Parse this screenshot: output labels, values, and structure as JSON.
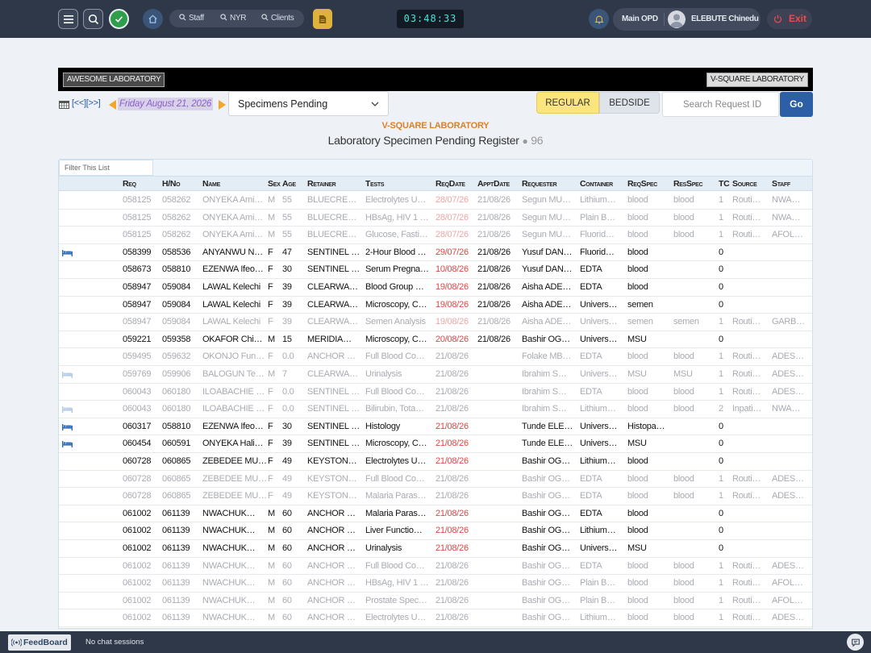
{
  "topbar": {
    "search_items": [
      {
        "label": "Staff",
        "icon": "search-icon"
      },
      {
        "label": "NYR",
        "icon": "search-icon"
      },
      {
        "label": "Clients",
        "icon": "search-icon"
      }
    ],
    "clock": "03:48:33",
    "department": "Main OPD",
    "user_name": "ELEBUTE Chinedu",
    "exit_label": "Exit"
  },
  "labbar": {
    "left_button": "AWESOME LABORATORY",
    "right_button": "V-SQUARE LABORATORY"
  },
  "controls": {
    "nav_links": "[<<][>>]",
    "date": "Friday August 21, 2026",
    "filter_select": "Specimens Pending",
    "segment_regular": "REGULAR",
    "segment_bedside": "BEDSIDE",
    "search_placeholder": "Search Request ID",
    "go_label": "Go"
  },
  "header": {
    "lab_name": "V-SQUARE LABORATORY",
    "register_title": "Laboratory Specimen Pending Register",
    "count": "96"
  },
  "table": {
    "filter_placeholder": "Filter This List",
    "columns": [
      "Req",
      "H/No",
      "Name",
      "Sex",
      "Age",
      "Retainer",
      "Tests",
      "ReqDate",
      "ApptDate",
      "Requester",
      "Container",
      "ReqSpec",
      "ResSpec",
      "TC",
      "Source",
      "Staff"
    ],
    "rows": [
      {
        "faded": true,
        "bed": false,
        "overdue": true,
        "cells": [
          "058125",
          "058262",
          "ONYEKA Ami…",
          "M",
          "55",
          "BLUECRE…",
          "Electrolytes U…",
          "28/07/26",
          "21/08/26",
          "Segun MU…",
          "Lithium…",
          "blood",
          "blood",
          "1",
          "Routi…",
          "NWA…"
        ]
      },
      {
        "faded": true,
        "bed": false,
        "overdue": true,
        "cells": [
          "058125",
          "058262",
          "ONYEKA Ami…",
          "M",
          "55",
          "BLUECRE…",
          "HBsAg, HIV 1 …",
          "28/07/26",
          "21/08/26",
          "Segun MU…",
          "Plain B…",
          "blood",
          "blood",
          "1",
          "Routi…",
          "NWA…"
        ]
      },
      {
        "faded": true,
        "bed": false,
        "overdue": true,
        "cells": [
          "058125",
          "058262",
          "ONYEKA Ami…",
          "M",
          "55",
          "BLUECRE…",
          "Glucose, Fasti…",
          "28/07/26",
          "21/08/26",
          "Segun MU…",
          "Fluorid…",
          "blood",
          "blood",
          "1",
          "Routi…",
          "AFOL…"
        ]
      },
      {
        "faded": false,
        "bed": true,
        "overdue": true,
        "cells": [
          "058399",
          "058536",
          "ANYANWU N…",
          "F",
          "47",
          "SENTINEL …",
          "2-Hour Blood …",
          "29/07/26",
          "21/08/26",
          "Yusuf DAN…",
          "Fluorid…",
          "blood",
          "",
          "0",
          "",
          ""
        ]
      },
      {
        "faded": false,
        "bed": false,
        "overdue": true,
        "cells": [
          "058673",
          "058810",
          "EZENWA Ifeo…",
          "F",
          "30",
          "SENTINEL …",
          "Serum Pregna…",
          "10/08/26",
          "21/08/26",
          "Yusuf DAN…",
          "EDTA",
          "blood",
          "",
          "0",
          "",
          ""
        ]
      },
      {
        "faded": false,
        "bed": false,
        "overdue": true,
        "cells": [
          "058947",
          "059084",
          "LAWAL Kelechi",
          "F",
          "39",
          "CLEARWA…",
          "Blood Group …",
          "19/08/26",
          "21/08/26",
          "Aisha ADE…",
          "EDTA",
          "blood",
          "",
          "0",
          "",
          ""
        ]
      },
      {
        "faded": false,
        "bed": false,
        "overdue": true,
        "cells": [
          "058947",
          "059084",
          "LAWAL Kelechi",
          "F",
          "39",
          "CLEARWA…",
          "Microscopy, C…",
          "19/08/26",
          "21/08/26",
          "Aisha ADE…",
          "Univers…",
          "semen",
          "",
          "0",
          "",
          ""
        ]
      },
      {
        "faded": true,
        "bed": false,
        "overdue": true,
        "cells": [
          "058947",
          "059084",
          "LAWAL Kelechi",
          "F",
          "39",
          "CLEARWA…",
          "Semen Analysis",
          "19/08/26",
          "21/08/26",
          "Aisha ADE…",
          "Univers…",
          "semen",
          "semen",
          "1",
          "Routi…",
          "GARB…"
        ]
      },
      {
        "faded": false,
        "bed": false,
        "overdue": true,
        "cells": [
          "059221",
          "059358",
          "OKAFOR Chi…",
          "M",
          "15",
          "MERIDIA…",
          "Microscopy, C…",
          "20/08/26",
          "21/08/26",
          "Bashir OG…",
          "Univers…",
          "MSU",
          "",
          "0",
          "",
          ""
        ]
      },
      {
        "faded": true,
        "bed": false,
        "overdue": false,
        "cells": [
          "059495",
          "059632",
          "OKONJO Fun…",
          "F",
          "0.0",
          "ANCHOR …",
          "Full Blood Co…",
          "21/08/26",
          "",
          "Folake MB…",
          "EDTA",
          "blood",
          "blood",
          "1",
          "Routi…",
          "ADES…"
        ]
      },
      {
        "faded": true,
        "bed": true,
        "overdue": false,
        "cells": [
          "059769",
          "059906",
          "BALOGUN Te…",
          "M",
          "7",
          "CLEARWA…",
          "Urinalysis",
          "21/08/26",
          "",
          "Ibrahim S…",
          "Univers…",
          "MSU",
          "MSU",
          "1",
          "Routi…",
          "ADES…"
        ]
      },
      {
        "faded": true,
        "bed": false,
        "overdue": false,
        "cells": [
          "060043",
          "060180",
          "ILOABACHIE …",
          "F",
          "0.0",
          "SENTINEL …",
          "Full Blood Co…",
          "21/08/26",
          "",
          "Ibrahim S…",
          "EDTA",
          "blood",
          "blood",
          "1",
          "Routi…",
          "ADES…"
        ]
      },
      {
        "faded": true,
        "bed": true,
        "overdue": false,
        "cells": [
          "060043",
          "060180",
          "ILOABACHIE …",
          "F",
          "0.0",
          "SENTINEL …",
          "Bilirubin, Tota…",
          "21/08/26",
          "",
          "Ibrahim S…",
          "Lithium…",
          "blood",
          "blood",
          "2",
          "Inpati…",
          "NWA…"
        ]
      },
      {
        "faded": false,
        "bed": true,
        "overdue": false,
        "cells": [
          "060317",
          "058810",
          "EZENWA Ifeo…",
          "F",
          "30",
          "SENTINEL …",
          "Histology",
          "21/08/26",
          "",
          "Tunde ELE…",
          "Univers…",
          "Histopa…",
          "",
          "0",
          "",
          ""
        ]
      },
      {
        "faded": false,
        "bed": true,
        "overdue": false,
        "cells": [
          "060454",
          "060591",
          "ONYEKA Hali…",
          "F",
          "39",
          "SENTINEL …",
          "Microscopy, C…",
          "21/08/26",
          "",
          "Tunde ELE…",
          "Univers…",
          "MSU",
          "",
          "0",
          "",
          ""
        ]
      },
      {
        "faded": false,
        "bed": false,
        "overdue": false,
        "cells": [
          "060728",
          "060865",
          "ZEBEDEE MU…",
          "F",
          "49",
          "KEYSTON…",
          "Electrolytes U…",
          "21/08/26",
          "",
          "Bashir OG…",
          "Lithium…",
          "blood",
          "",
          "0",
          "",
          ""
        ]
      },
      {
        "faded": true,
        "bed": false,
        "overdue": false,
        "cells": [
          "060728",
          "060865",
          "ZEBEDEE MU…",
          "F",
          "49",
          "KEYSTON…",
          "Full Blood Co…",
          "21/08/26",
          "",
          "Bashir OG…",
          "EDTA",
          "blood",
          "blood",
          "1",
          "Routi…",
          "ADES…"
        ]
      },
      {
        "faded": true,
        "bed": false,
        "overdue": false,
        "cells": [
          "060728",
          "060865",
          "ZEBEDEE MU…",
          "F",
          "49",
          "KEYSTON…",
          "Malaria Paras…",
          "21/08/26",
          "",
          "Bashir OG…",
          "EDTA",
          "blood",
          "blood",
          "1",
          "Routi…",
          "ADES…"
        ]
      },
      {
        "faded": false,
        "bed": false,
        "overdue": false,
        "cells": [
          "061002",
          "061139",
          "NWACHUK…",
          "M",
          "60",
          "ANCHOR …",
          "Malaria Paras…",
          "21/08/26",
          "",
          "Bashir OG…",
          "EDTA",
          "blood",
          "",
          "0",
          "",
          ""
        ]
      },
      {
        "faded": false,
        "bed": false,
        "overdue": false,
        "cells": [
          "061002",
          "061139",
          "NWACHUK…",
          "M",
          "60",
          "ANCHOR …",
          "Liver Functio…",
          "21/08/26",
          "",
          "Bashir OG…",
          "Lithium…",
          "blood",
          "",
          "0",
          "",
          ""
        ]
      },
      {
        "faded": false,
        "bed": false,
        "overdue": false,
        "cells": [
          "061002",
          "061139",
          "NWACHUK…",
          "M",
          "60",
          "ANCHOR …",
          "Urinalysis",
          "21/08/26",
          "",
          "Bashir OG…",
          "Univers…",
          "MSU",
          "",
          "0",
          "",
          ""
        ]
      },
      {
        "faded": true,
        "bed": false,
        "overdue": false,
        "cells": [
          "061002",
          "061139",
          "NWACHUK…",
          "M",
          "60",
          "ANCHOR …",
          "Full Blood Co…",
          "21/08/26",
          "",
          "Bashir OG…",
          "EDTA",
          "blood",
          "blood",
          "1",
          "Routi…",
          "ADES…"
        ]
      },
      {
        "faded": true,
        "bed": false,
        "overdue": false,
        "cells": [
          "061002",
          "061139",
          "NWACHUK…",
          "M",
          "60",
          "ANCHOR …",
          "HBsAg, HIV 1 …",
          "21/08/26",
          "",
          "Bashir OG…",
          "Plain B…",
          "blood",
          "blood",
          "1",
          "Routi…",
          "AFOL…"
        ]
      },
      {
        "faded": true,
        "bed": false,
        "overdue": false,
        "cells": [
          "061002",
          "061139",
          "NWACHUK…",
          "M",
          "60",
          "ANCHOR …",
          "Prostate Spec…",
          "21/08/26",
          "",
          "Bashir OG…",
          "Plain B…",
          "blood",
          "blood",
          "1",
          "Routi…",
          "AFOL…"
        ]
      },
      {
        "faded": true,
        "bed": false,
        "overdue": false,
        "cells": [
          "061002",
          "061139",
          "NWACHUK…",
          "M",
          "60",
          "ANCHOR …",
          "Electrolytes U…",
          "21/08/26",
          "",
          "Bashir OG…",
          "Lithium…",
          "blood",
          "blood",
          "1",
          "Routi…",
          "ADES…"
        ]
      }
    ]
  },
  "footer": {
    "feedboard_label": "FeedBoard",
    "chat_status": "No chat sessions"
  },
  "colors": {
    "topbar": "#2e3849",
    "accent_blue": "#2c5fa6",
    "overdue_date": "#e04545",
    "lab_title": "#d9822b",
    "regular_active": "#fbe57c",
    "exit_red": "#ec4b4b"
  }
}
